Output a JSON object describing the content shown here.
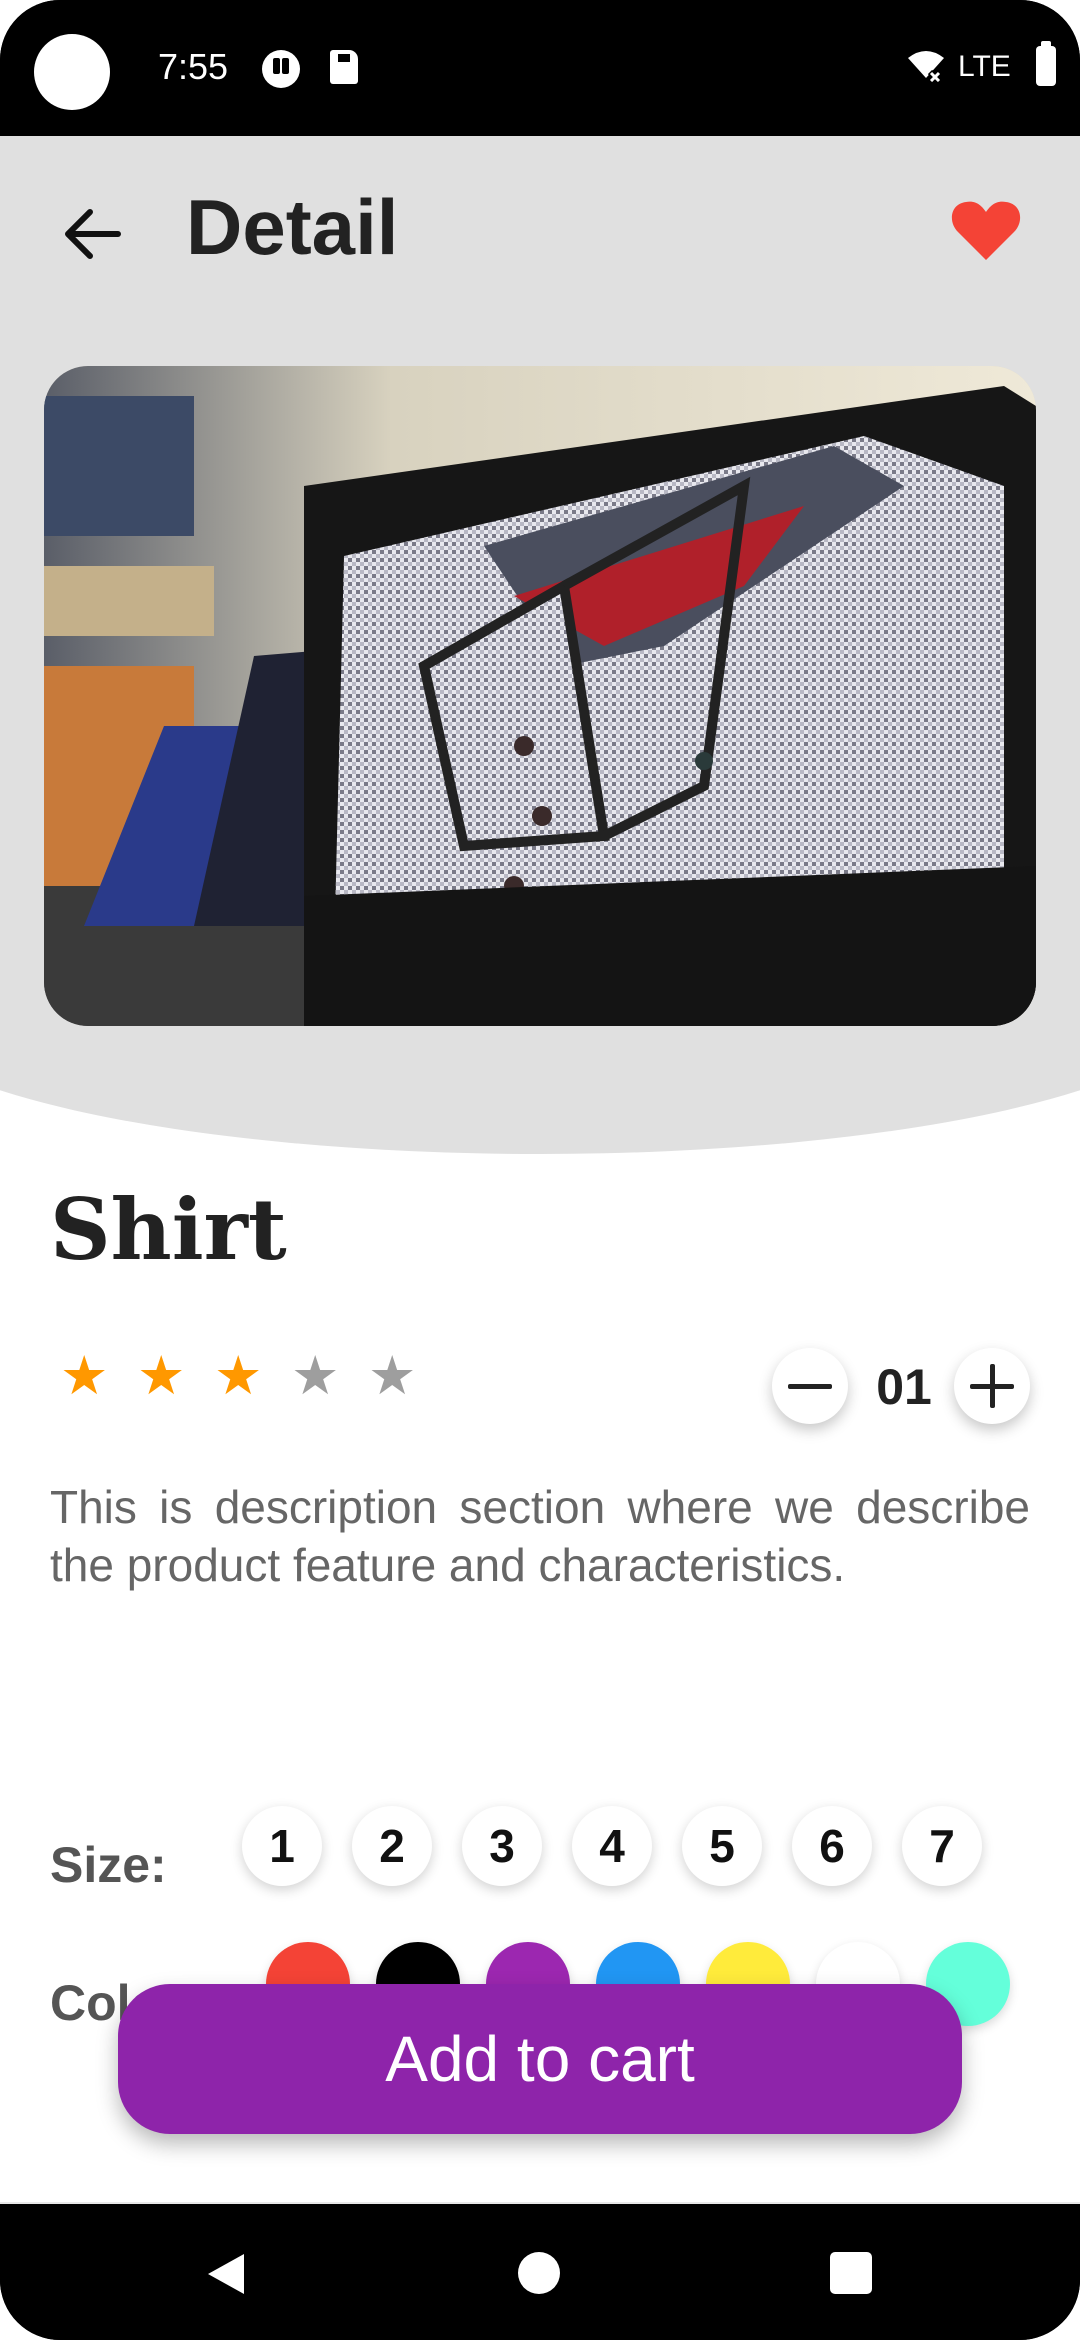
{
  "status_bar": {
    "time": "7:55",
    "network": "LTE"
  },
  "header": {
    "title": "Detail",
    "back_icon": "arrow-back-icon",
    "favorite_icon": "heart-icon",
    "favorite_color": "#f44336"
  },
  "product": {
    "name": "Shirt",
    "image_subject": "folded checkered shirts in boxes",
    "rating": {
      "value": 3,
      "max": 5,
      "filled_color": "#ff9800",
      "empty_color": "#9e9e9e"
    },
    "quantity": "01",
    "description": "This is description section where we describe the product feature and characteristics."
  },
  "size": {
    "label": "Size:",
    "options": [
      "1",
      "2",
      "3",
      "4",
      "5",
      "6",
      "7"
    ]
  },
  "color": {
    "label": "Color:",
    "options": [
      "#f44336",
      "#000000",
      "#9c27b0",
      "#2196f3",
      "#ffeb3b",
      "#ffffff",
      "#64ffda"
    ]
  },
  "cart": {
    "button_label": "Add to cart",
    "button_color": "#8e24aa"
  },
  "nav_bar": {
    "icons": [
      "nav-back-icon",
      "nav-home-icon",
      "nav-recent-icon"
    ]
  }
}
